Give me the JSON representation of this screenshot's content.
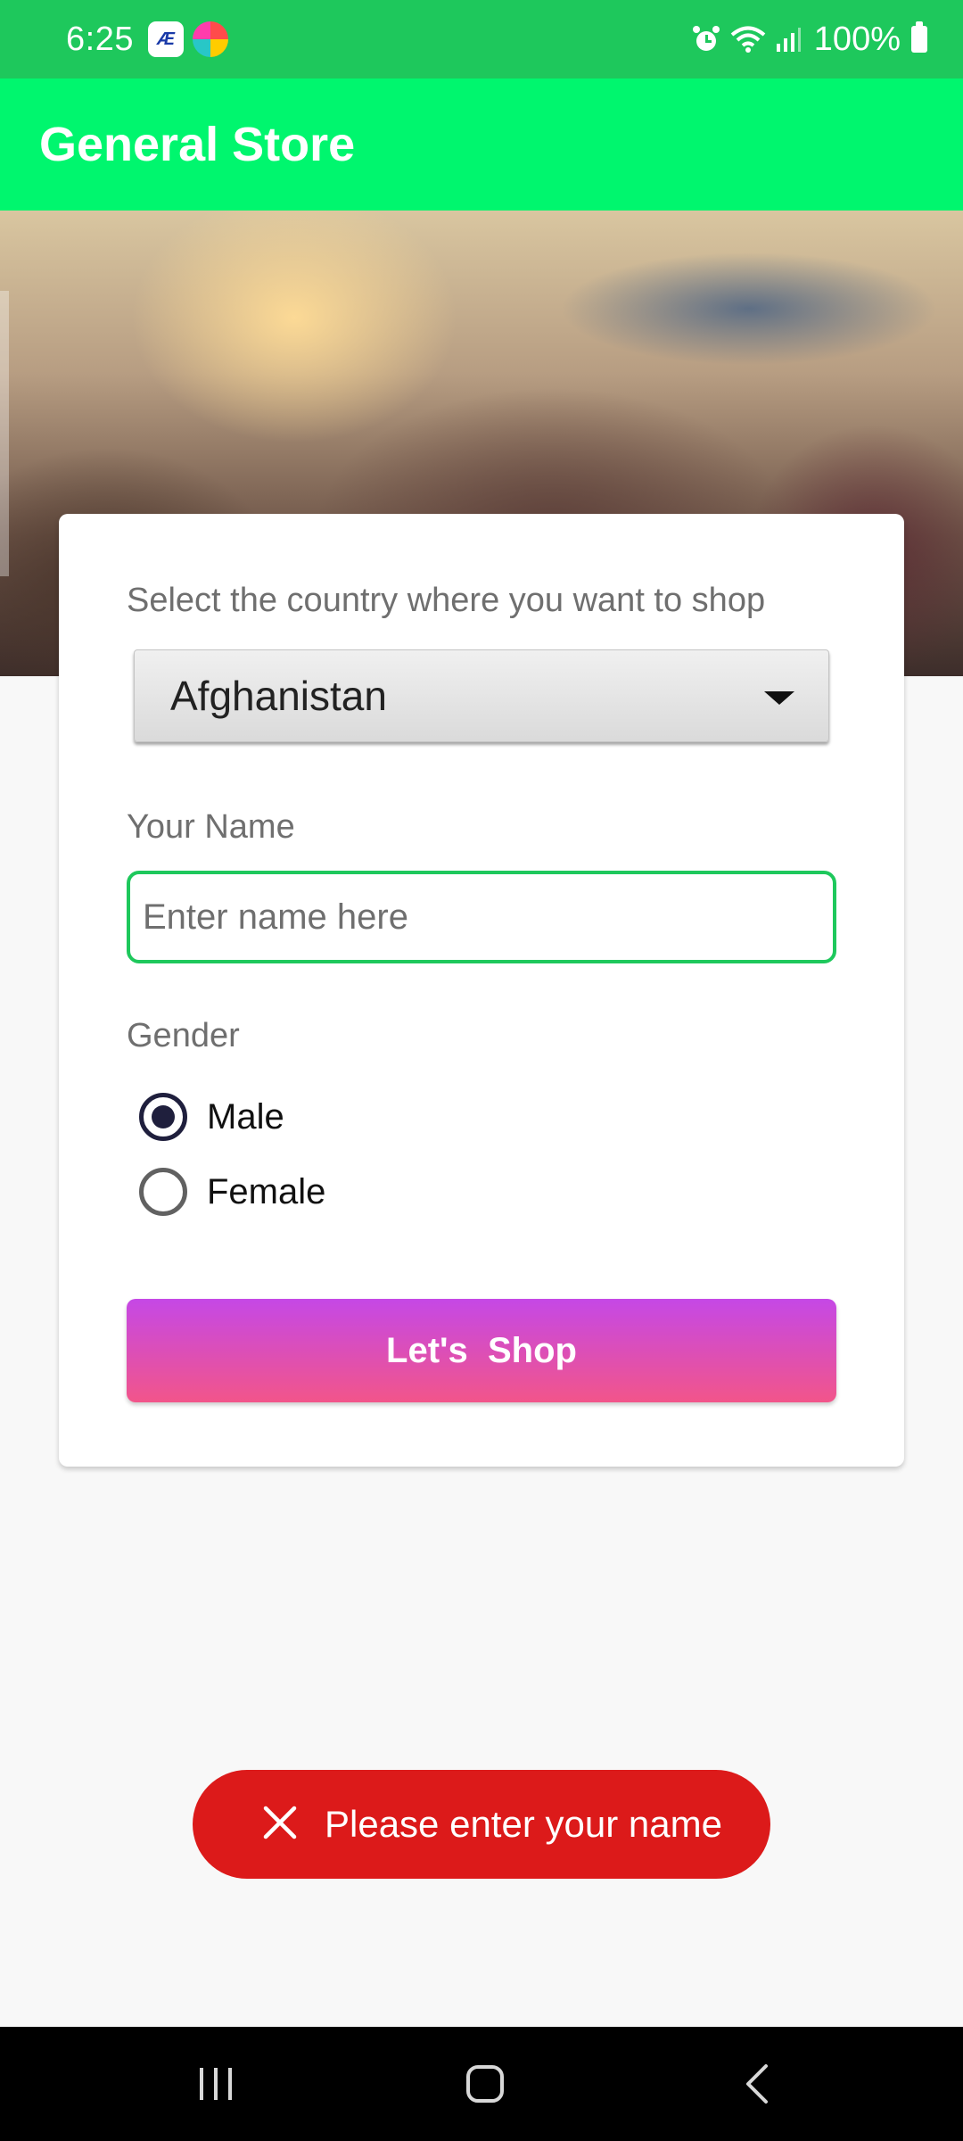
{
  "status_bar": {
    "time": "6:25",
    "battery": "100%",
    "notification_icons": [
      "ae-app-icon",
      "color-app-icon"
    ],
    "system_icons": [
      "alarm-icon",
      "wifi-icon",
      "signal-icon",
      "battery-icon"
    ]
  },
  "app_bar": {
    "title": "General Store",
    "color": "#00f66e"
  },
  "form": {
    "country_label": "Select the country where you want to shop",
    "country_selected": "Afghanistan",
    "name_label": "Your Name",
    "name_placeholder": "Enter name here",
    "name_value": "",
    "gender_label": "Gender",
    "gender_options": [
      {
        "label": "Male",
        "checked": true
      },
      {
        "label": "Female",
        "checked": false
      }
    ],
    "submit_label": "Let's  Shop"
  },
  "toast": {
    "icon": "close-icon",
    "message": "Please enter your name",
    "color": "#dc1a1a"
  },
  "nav_bar": {
    "buttons": [
      "recents-icon",
      "home-icon",
      "back-icon"
    ]
  }
}
